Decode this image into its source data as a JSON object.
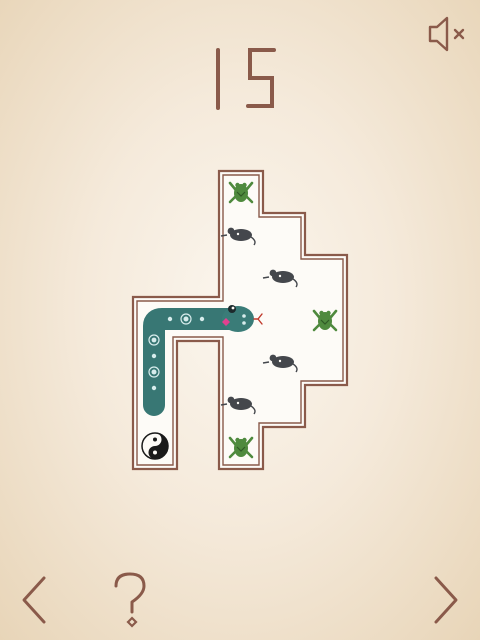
{
  "hud": {
    "level_number": "15",
    "sound": {
      "muted": true,
      "icon": "speaker-muted-icon"
    }
  },
  "board": {
    "pieces": [
      {
        "kind": "frog",
        "icon": "frog-icon"
      },
      {
        "kind": "mouse",
        "icon": "mouse-icon"
      },
      {
        "kind": "mouse",
        "icon": "mouse-icon"
      },
      {
        "kind": "frog",
        "icon": "frog-icon"
      },
      {
        "kind": "mouse",
        "icon": "mouse-icon"
      },
      {
        "kind": "mouse",
        "icon": "mouse-icon"
      },
      {
        "kind": "frog",
        "icon": "frog-icon"
      },
      {
        "kind": "yin-yang",
        "icon": "yin-yang-icon"
      }
    ],
    "snake": {
      "icon": "snake-icon",
      "color": "#3a7c78"
    }
  },
  "nav": {
    "prev_icon": "chevron-left-icon",
    "help_icon": "question-mark-icon",
    "next_icon": "chevron-right-icon"
  },
  "colors": {
    "wall": "#8a5a4a",
    "floor": "#fdfbf7",
    "frog": "#4f8a3e",
    "mouse": "#44474c",
    "snake": "#3a7c78",
    "snake_eye_patch": "#e2418f"
  }
}
